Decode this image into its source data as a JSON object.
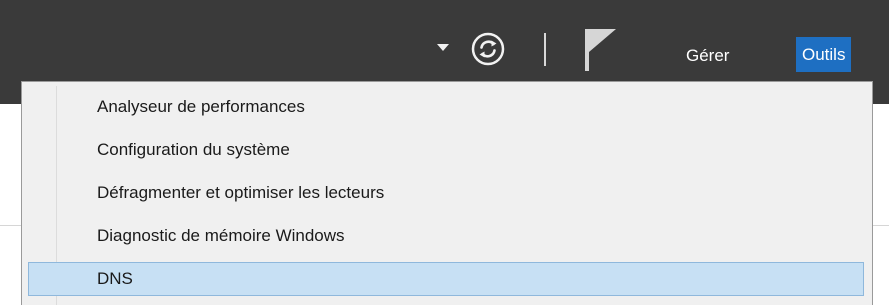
{
  "toolbar": {
    "dropdown_icon": "chevron-down-icon",
    "refresh_icon": "refresh-icon",
    "flag_icon": "flag-icon",
    "manage_label": "Gérer",
    "tools_label": "Outils",
    "accent_color": "#1e6fc2",
    "bar_color": "#3a3a3a"
  },
  "tools_menu": {
    "items": [
      {
        "label": "Analyseur de performances"
      },
      {
        "label": "Configuration du système"
      },
      {
        "label": "Défragmenter et optimiser les lecteurs"
      },
      {
        "label": "Diagnostic de mémoire Windows"
      },
      {
        "label": "DNS",
        "hovered": true
      }
    ],
    "hover_color": "#c7e0f4"
  }
}
